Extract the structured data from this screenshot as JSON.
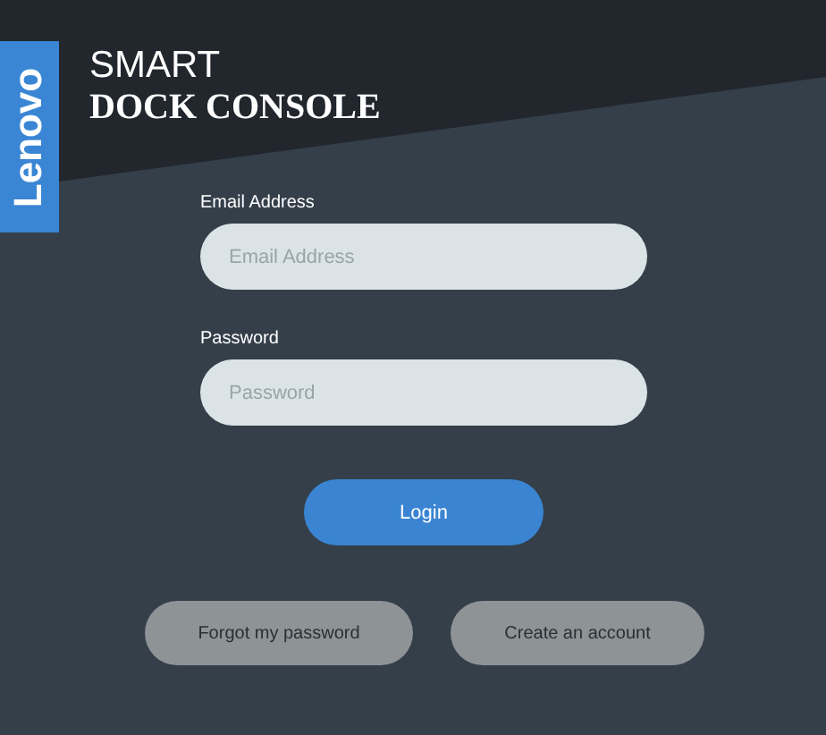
{
  "logo": {
    "text": "Lenovo"
  },
  "title": {
    "line_1": "SMART",
    "line_2": "DOCK CONSOLE"
  },
  "fields": [
    {
      "label": "Email Address",
      "placeholder": "Email Address"
    },
    {
      "label": "Password",
      "placeholder": "Password"
    }
  ],
  "login_button": "Login",
  "links": [
    "Forgot my password",
    "Create an account"
  ]
}
